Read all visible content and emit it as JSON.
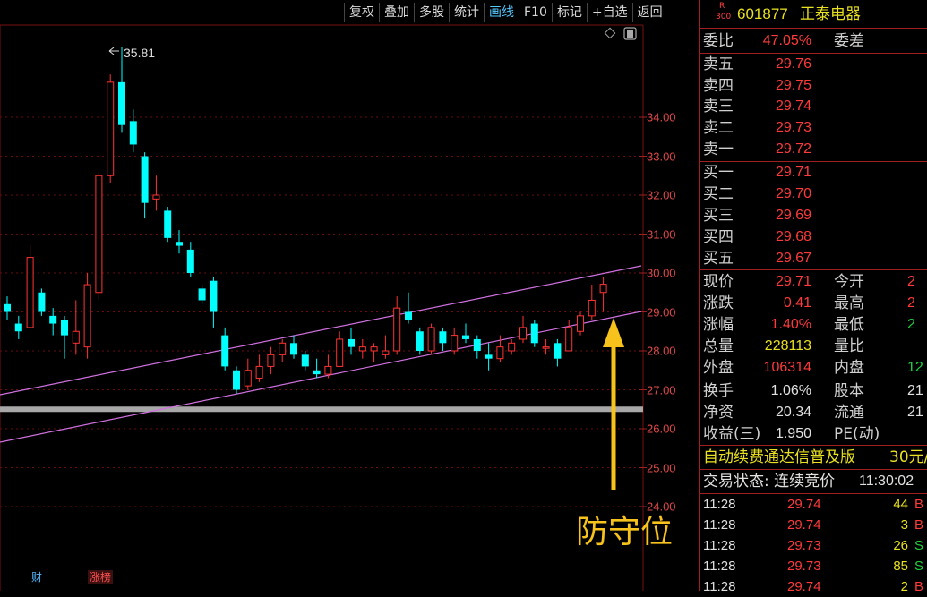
{
  "toolbar": {
    "items": [
      "复权",
      "叠加",
      "多股",
      "统计",
      "画线",
      "F10",
      "标记",
      "+自选",
      "返回"
    ],
    "active": "画线"
  },
  "chart": {
    "y_labels": [
      "34.00",
      "33.00",
      "32.00",
      "31.00",
      "30.00",
      "29.00",
      "28.00",
      "27.00",
      "26.00",
      "25.00",
      "24.00"
    ],
    "peak_label": "35.81",
    "annotation": "防守位",
    "badges": [
      "财",
      "涨榜"
    ],
    "colors": {
      "up": "#ff3333",
      "down": "#00ffff",
      "channel": "#d070e0",
      "support": "#a8a8a8",
      "arrow": "#f7c21b"
    }
  },
  "chart_data": {
    "type": "candlestick",
    "ylim": [
      24.0,
      35.81
    ],
    "peak": 35.81,
    "support_level": 26.5,
    "candles": [
      {
        "o": 29.2,
        "c": 29.0,
        "h": 29.4,
        "l": 28.8
      },
      {
        "o": 28.7,
        "c": 28.5,
        "h": 28.9,
        "l": 28.3
      },
      {
        "o": 28.6,
        "c": 30.4,
        "h": 30.7,
        "l": 28.6
      },
      {
        "o": 29.5,
        "c": 29.0,
        "h": 29.6,
        "l": 28.9
      },
      {
        "o": 28.9,
        "c": 28.7,
        "h": 29.1,
        "l": 28.4
      },
      {
        "o": 28.8,
        "c": 28.4,
        "h": 28.9,
        "l": 27.8
      },
      {
        "o": 28.2,
        "c": 28.5,
        "h": 29.3,
        "l": 27.9
      },
      {
        "o": 28.1,
        "c": 29.7,
        "h": 30.0,
        "l": 27.8
      },
      {
        "o": 29.5,
        "c": 32.5,
        "h": 32.6,
        "l": 29.3
      },
      {
        "o": 32.5,
        "c": 34.9,
        "h": 35.1,
        "l": 32.3
      },
      {
        "o": 34.9,
        "c": 33.8,
        "h": 35.81,
        "l": 33.6
      },
      {
        "o": 33.9,
        "c": 33.3,
        "h": 34.2,
        "l": 33.1
      },
      {
        "o": 33.0,
        "c": 31.8,
        "h": 33.1,
        "l": 31.4
      },
      {
        "o": 31.9,
        "c": 32.0,
        "h": 32.5,
        "l": 31.6
      },
      {
        "o": 31.6,
        "c": 30.9,
        "h": 31.7,
        "l": 30.8
      },
      {
        "o": 30.8,
        "c": 30.7,
        "h": 31.1,
        "l": 30.5
      },
      {
        "o": 30.6,
        "c": 30.0,
        "h": 30.8,
        "l": 29.9
      },
      {
        "o": 29.6,
        "c": 29.3,
        "h": 29.7,
        "l": 29.2
      },
      {
        "o": 29.8,
        "c": 29.0,
        "h": 29.9,
        "l": 28.6
      },
      {
        "o": 28.4,
        "c": 27.6,
        "h": 28.6,
        "l": 27.5
      },
      {
        "o": 27.5,
        "c": 27.0,
        "h": 27.6,
        "l": 26.9
      },
      {
        "o": 27.1,
        "c": 27.5,
        "h": 27.8,
        "l": 27.0
      },
      {
        "o": 27.3,
        "c": 27.6,
        "h": 27.9,
        "l": 27.2
      },
      {
        "o": 27.6,
        "c": 27.9,
        "h": 28.1,
        "l": 27.4
      },
      {
        "o": 27.9,
        "c": 28.2,
        "h": 28.3,
        "l": 27.7
      },
      {
        "o": 28.2,
        "c": 27.9,
        "h": 28.4,
        "l": 27.8
      },
      {
        "o": 27.9,
        "c": 27.6,
        "h": 28.0,
        "l": 27.5
      },
      {
        "o": 27.5,
        "c": 27.4,
        "h": 27.8,
        "l": 27.3
      },
      {
        "o": 27.4,
        "c": 27.6,
        "h": 27.9,
        "l": 27.3
      },
      {
        "o": 27.6,
        "c": 28.3,
        "h": 28.5,
        "l": 27.6
      },
      {
        "o": 28.3,
        "c": 28.1,
        "h": 28.6,
        "l": 27.9
      },
      {
        "o": 28.0,
        "c": 28.1,
        "h": 28.3,
        "l": 27.8
      },
      {
        "o": 28.0,
        "c": 28.1,
        "h": 28.2,
        "l": 27.7
      },
      {
        "o": 27.9,
        "c": 28.0,
        "h": 28.4,
        "l": 27.8
      },
      {
        "o": 28.0,
        "c": 29.1,
        "h": 29.4,
        "l": 27.9
      },
      {
        "o": 29.0,
        "c": 28.8,
        "h": 29.5,
        "l": 28.7
      },
      {
        "o": 28.5,
        "c": 28.0,
        "h": 28.6,
        "l": 27.9
      },
      {
        "o": 28.0,
        "c": 28.6,
        "h": 28.7,
        "l": 27.9
      },
      {
        "o": 28.5,
        "c": 28.2,
        "h": 28.6,
        "l": 28.0
      },
      {
        "o": 28.0,
        "c": 28.4,
        "h": 28.6,
        "l": 27.9
      },
      {
        "o": 28.4,
        "c": 28.3,
        "h": 28.7,
        "l": 28.2
      },
      {
        "o": 28.3,
        "c": 28.0,
        "h": 28.4,
        "l": 27.8
      },
      {
        "o": 27.9,
        "c": 27.8,
        "h": 28.2,
        "l": 27.5
      },
      {
        "o": 27.8,
        "c": 28.1,
        "h": 28.4,
        "l": 27.7
      },
      {
        "o": 28.0,
        "c": 28.2,
        "h": 28.3,
        "l": 27.9
      },
      {
        "o": 28.3,
        "c": 28.6,
        "h": 28.9,
        "l": 28.2
      },
      {
        "o": 28.7,
        "c": 28.2,
        "h": 28.8,
        "l": 28.1
      },
      {
        "o": 28.1,
        "c": 28.1,
        "h": 28.3,
        "l": 27.9
      },
      {
        "o": 28.2,
        "c": 27.8,
        "h": 28.3,
        "l": 27.6
      },
      {
        "o": 28.0,
        "c": 28.6,
        "h": 28.8,
        "l": 28.0
      },
      {
        "o": 28.5,
        "c": 28.9,
        "h": 29.0,
        "l": 28.4
      },
      {
        "o": 28.9,
        "c": 29.3,
        "h": 29.7,
        "l": 28.8
      },
      {
        "o": 29.5,
        "c": 29.71,
        "h": 29.9,
        "l": 29.0
      }
    ]
  },
  "panel": {
    "stock_badge_top": "R",
    "stock_badge_bottom": "300",
    "code": "601877",
    "name": "正泰电器",
    "weibi_label": "委比",
    "weibi_value": "47.05%",
    "weicha_label": "委差",
    "sell": [
      {
        "label": "卖五",
        "price": "29.76"
      },
      {
        "label": "卖四",
        "price": "29.75"
      },
      {
        "label": "卖三",
        "price": "29.74"
      },
      {
        "label": "卖二",
        "price": "29.73"
      },
      {
        "label": "卖一",
        "price": "29.72"
      }
    ],
    "buy": [
      {
        "label": "买一",
        "price": "29.71"
      },
      {
        "label": "买二",
        "price": "29.70"
      },
      {
        "label": "买三",
        "price": "29.69"
      },
      {
        "label": "买四",
        "price": "29.68"
      },
      {
        "label": "买五",
        "price": "29.67"
      }
    ],
    "quote": [
      {
        "l1": "现价",
        "v1": "29.71",
        "c1": "red",
        "l2": "今开",
        "v2": "2",
        "c2": "red"
      },
      {
        "l1": "涨跌",
        "v1": "0.41",
        "c1": "red",
        "l2": "最高",
        "v2": "2",
        "c2": "red"
      },
      {
        "l1": "涨幅",
        "v1": "1.40%",
        "c1": "red",
        "l2": "最低",
        "v2": "2",
        "c2": "green"
      },
      {
        "l1": "总量",
        "v1": "228113",
        "c1": "yellow",
        "l2": "量比",
        "v2": "",
        "c2": "white"
      },
      {
        "l1": "外盘",
        "v1": "106314",
        "c1": "red",
        "l2": "内盘",
        "v2": "12",
        "c2": "green"
      }
    ],
    "fund": [
      {
        "l1": "换手",
        "v1": "1.06%",
        "l2": "股本",
        "v2": "21"
      },
      {
        "l1": "净资",
        "v1": "20.34",
        "l2": "流通",
        "v2": "21"
      },
      {
        "l1": "收益(三)",
        "v1": "1.950",
        "l2": "PE(动)",
        "v2": ""
      }
    ],
    "ad_text": "自动续费通达信普及版",
    "ad_price": "30元/",
    "trade_status_label": "交易状态: 连续竞价",
    "trade_status_time": "11:30:02",
    "ticks": [
      {
        "time": "11:28",
        "price": "29.74",
        "vol": "44",
        "side": "B"
      },
      {
        "time": "11:28",
        "price": "29.74",
        "vol": "3",
        "side": "B"
      },
      {
        "time": "11:28",
        "price": "29.73",
        "vol": "26",
        "side": "S"
      },
      {
        "time": "11:28",
        "price": "29.73",
        "vol": "85",
        "side": "S"
      },
      {
        "time": "11:28",
        "price": "29.74",
        "vol": "2",
        "side": "B"
      }
    ]
  }
}
